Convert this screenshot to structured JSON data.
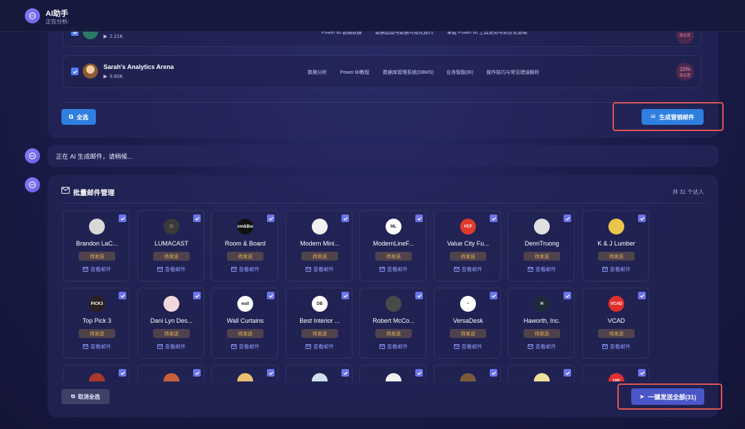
{
  "header": {
    "title": "AI助手",
    "subtitle": "正在分析:"
  },
  "top_rows": [
    {
      "name": "",
      "views": "2.21K",
      "tags": [
        "Power BI 数据数据",
        "数据建模与数据可视化技巧",
        "掌握 Power BI 工具使用与商业化策略"
      ],
      "pct": "",
      "pct_label": "相关度",
      "avatar_color": "#2a7a66"
    },
    {
      "name": "Sarah's Analytics Arena",
      "views": "3.80K",
      "tags": [
        "数据分析",
        "Power BI教程",
        "数据库管理系统(DBMS)",
        "业务智能(BI)",
        "操作技巧与常见错误解析"
      ],
      "pct": "10%",
      "pct_label": "相关度",
      "avatar_color": "#c98a4a"
    }
  ],
  "select_all_label": "全选",
  "generate_label": "生成营销邮件",
  "status_message": "正在 AI 生成邮件，请稍候...",
  "email_manager": {
    "title": "批量邮件管理",
    "count_text": "共 31 个达人",
    "status_label": "待发送",
    "view_label": "查看邮件",
    "cards": [
      {
        "name": "Brandon LaC...",
        "logo_text": "",
        "logo_bg": "#d8d8d8"
      },
      {
        "name": "LUMACAST",
        "logo_text": "⬡",
        "logo_bg": "#3a3a3a"
      },
      {
        "name": "Room & Board",
        "logo_text": "Room&Board",
        "logo_bg": "#111111"
      },
      {
        "name": "Modern Mini...",
        "logo_text": "",
        "logo_bg": "#f2f2f2"
      },
      {
        "name": "ModernLineF...",
        "logo_text": "ML",
        "logo_bg": "#ffffff"
      },
      {
        "name": "Value City Fu...",
        "logo_text": "VCF",
        "logo_bg": "#e03a2b"
      },
      {
        "name": "DennTruong",
        "logo_text": "",
        "logo_bg": "#e0e0e0"
      },
      {
        "name": "K & J Lumber",
        "logo_text": "",
        "logo_bg": "#e8c64a"
      },
      {
        "name": "Top Pick 3",
        "logo_text": "PICK3",
        "logo_bg": "#2a2020"
      },
      {
        "name": "Dani Lyn Des...",
        "logo_text": "",
        "logo_bg": "#f0d8dc"
      },
      {
        "name": "Wall Curtains",
        "logo_text": "wall",
        "logo_bg": "#ffffff"
      },
      {
        "name": "Best Interior ...",
        "logo_text": "DB",
        "logo_bg": "#ffffff"
      },
      {
        "name": "Robert McCo...",
        "logo_text": "",
        "logo_bg": "#4a4a4a"
      },
      {
        "name": "VersaDesk",
        "logo_text": "~",
        "logo_bg": "#ffffff"
      },
      {
        "name": "Haworth, Inc.",
        "logo_text": "H",
        "logo_bg": "#1d2a3a"
      },
      {
        "name": "VCAD",
        "logo_text": "VCAD",
        "logo_bg": "#e0302a"
      },
      {
        "name": "",
        "logo_text": "",
        "logo_bg": "#a83a2a"
      },
      {
        "name": "",
        "logo_text": "",
        "logo_bg": "#c8603a"
      },
      {
        "name": "",
        "logo_text": "",
        "logo_bg": "#e8c070"
      },
      {
        "name": "",
        "logo_text": "",
        "logo_bg": "#d0e0f0"
      },
      {
        "name": "",
        "logo_text": "",
        "logo_bg": "#f2f2f2"
      },
      {
        "name": "",
        "logo_text": "",
        "logo_bg": "#7a5a3a"
      },
      {
        "name": "",
        "logo_text": "",
        "logo_bg": "#f0e0a0"
      },
      {
        "name": "",
        "logo_text": "1PE",
        "logo_bg": "#e03030"
      }
    ]
  },
  "deselect_all_label": "取消全选",
  "send_all_label": "一键发送全部(31)"
}
